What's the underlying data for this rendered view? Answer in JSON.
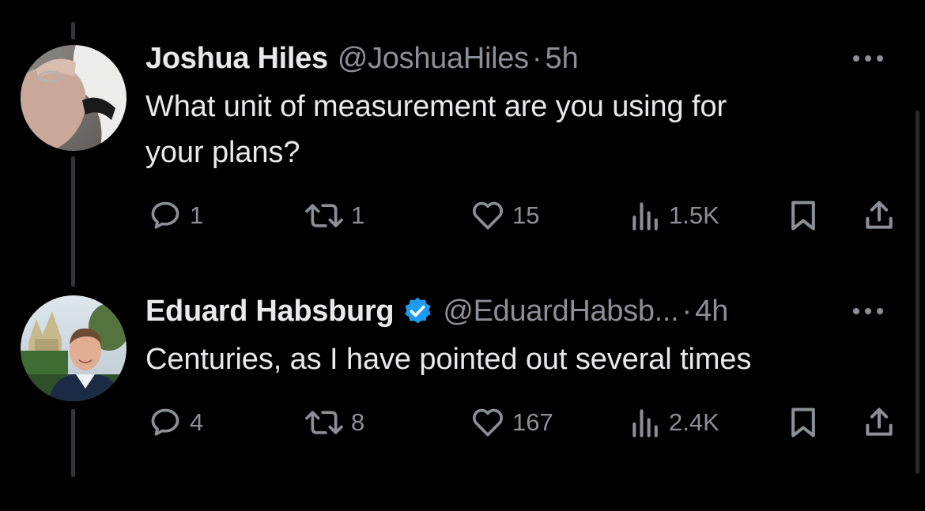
{
  "colors": {
    "background": "#000000",
    "primary_text": "#e7e9ea",
    "secondary_text": "#8b9096",
    "verified_blue": "#1d9bf0",
    "thread_line": "#333639"
  },
  "tweets": [
    {
      "name": "Joshua Hiles",
      "handle": "@JoshuaHiles",
      "separator": "·",
      "time": "5h",
      "verified": false,
      "text_lines": [
        "What unit of measurement are you using for",
        "your plans?"
      ],
      "avatar_icon": "user-photo",
      "more_icon": "more-horizontal-icon",
      "actions": {
        "replies": "1",
        "reposts": "1",
        "likes": "15",
        "views": "1.5K"
      }
    },
    {
      "name": "Eduard Habsburg",
      "handle": "@EduardHabsb...",
      "separator": "·",
      "time": "4h",
      "verified": true,
      "text_lines": [
        "Centuries, as I have pointed out several times"
      ],
      "avatar_icon": "user-photo",
      "more_icon": "more-horizontal-icon",
      "actions": {
        "replies": "4",
        "reposts": "8",
        "likes": "167",
        "views": "2.4K"
      }
    }
  ]
}
